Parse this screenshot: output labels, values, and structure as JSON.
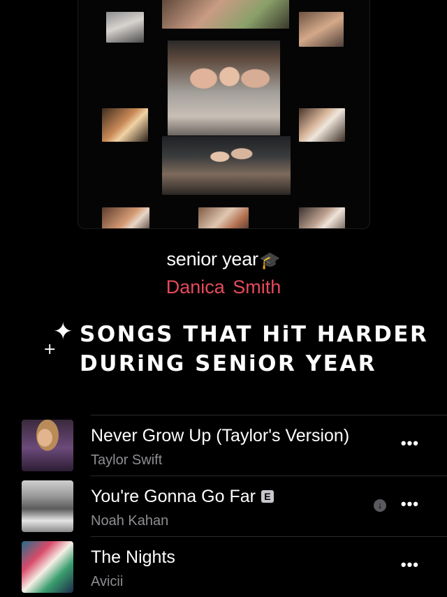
{
  "playlist": {
    "title": "senior year",
    "title_icon": "graduation-cap-icon",
    "owner": "Danica  Smith",
    "owner_color": "#e64a5a",
    "description_line1": "SONGS THAT HiT HARDER",
    "description_line2": "DURiNG SENiOR YEAR",
    "description_decoration": "sparkles-icon"
  },
  "songs": [
    {
      "title": "Never Grow Up (Taylor's Version)",
      "artist": "Taylor Swift",
      "explicit": false,
      "downloading": false,
      "more_label": "•••"
    },
    {
      "title": "You're Gonna Go Far",
      "artist": "Noah Kahan",
      "explicit": true,
      "explicit_label": "E",
      "downloading": true,
      "more_label": "•••"
    },
    {
      "title": "The Nights",
      "artist": "Avicii",
      "explicit": false,
      "downloading": false,
      "more_label": "•••"
    }
  ]
}
